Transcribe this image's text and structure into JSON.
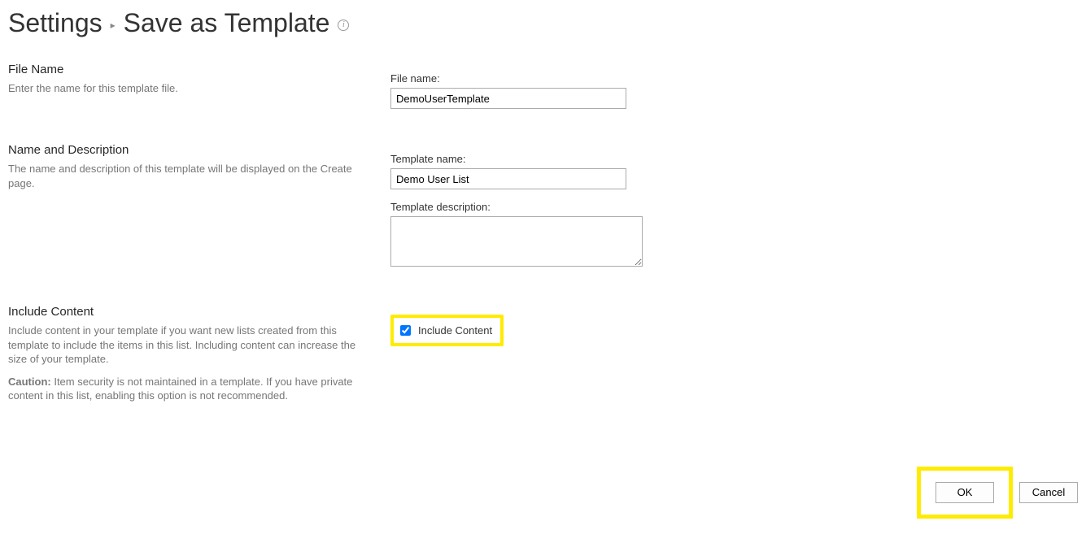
{
  "breadcrumb": {
    "settings": "Settings",
    "separator": "▸",
    "current": "Save as Template"
  },
  "sections": {
    "file_name": {
      "heading": "File Name",
      "desc": "Enter the name for this template file.",
      "field_label": "File name:",
      "value": "DemoUserTemplate"
    },
    "name_desc": {
      "heading": "Name and Description",
      "desc": "The name and description of this template will be displayed on the Create page.",
      "template_name_label": "Template name:",
      "template_name_value": "Demo User List",
      "template_desc_label": "Template description:",
      "template_desc_value": ""
    },
    "include_content": {
      "heading": "Include Content",
      "desc": "Include content in your template if you want new lists created from this template to include the items in this list. Including content can increase the size of your template.",
      "caution_label": "Caution:",
      "caution_text": " Item security is not maintained in a template. If you have private content in this list, enabling this option is not recommended.",
      "checkbox_label": "Include Content",
      "checked": true
    }
  },
  "buttons": {
    "ok": "OK",
    "cancel": "Cancel"
  }
}
